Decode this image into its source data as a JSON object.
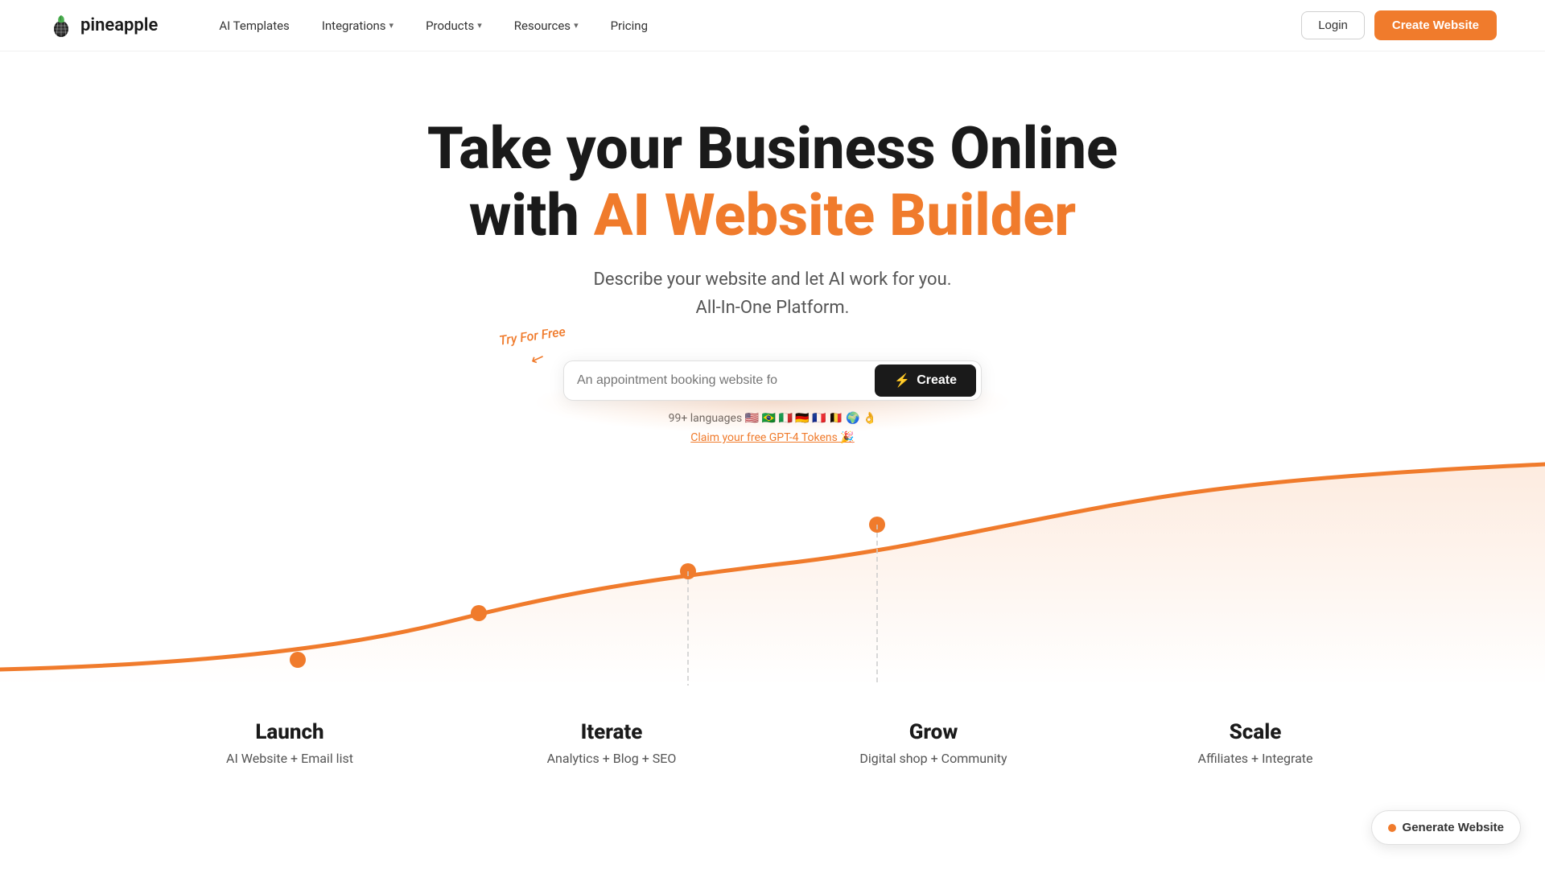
{
  "nav": {
    "logo_text": "pineapple",
    "links": [
      {
        "label": "AI Templates",
        "has_dropdown": false
      },
      {
        "label": "Integrations",
        "has_dropdown": true
      },
      {
        "label": "Products",
        "has_dropdown": true
      },
      {
        "label": "Resources",
        "has_dropdown": true
      },
      {
        "label": "Pricing",
        "has_dropdown": false
      }
    ],
    "login_label": "Login",
    "create_label": "Create Website"
  },
  "hero": {
    "title_line1": "Take your Business Online",
    "title_line2_plain": "with ",
    "title_line2_orange": "AI Website Builder",
    "subtitle_line1": "Describe your website and let AI work for you.",
    "subtitle_line2": "All-In-One Platform.",
    "try_for_free": "Try For Free",
    "search_placeholder": "An appointment booking website fo",
    "search_button": "Create",
    "languages_label": "99+ languages 🇺🇸 🇧🇷 🇮🇹 🇩🇪 🇫🇷 🇧🇪 🌍 👌",
    "claim_link": "Claim your free GPT-4 Tokens 🎉"
  },
  "stages": [
    {
      "title": "Launch",
      "description": "AI Website + Email list"
    },
    {
      "title": "Iterate",
      "description": "Analytics + Blog + SEO"
    },
    {
      "title": "Grow",
      "description": "Digital shop + Community"
    },
    {
      "title": "Scale",
      "description": "Affiliates + Integrate"
    }
  ],
  "floating_button": "Generate Website"
}
